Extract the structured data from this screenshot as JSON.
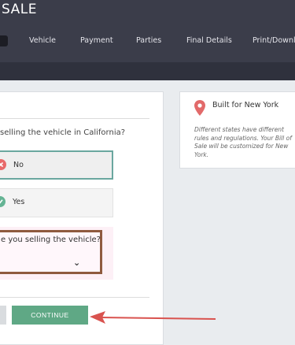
{
  "header": {
    "title": "SALE",
    "nav": [
      "Vehicle",
      "Payment",
      "Parties",
      "Final Details",
      "Print/Download"
    ]
  },
  "question": {
    "text": "selling the vehicle in California?",
    "options": [
      {
        "label": "No",
        "selected": true,
        "icon": "close-icon",
        "color": "#e8696a"
      },
      {
        "label": "Yes",
        "selected": false,
        "icon": "check-icon",
        "color": "#65b494"
      }
    ]
  },
  "subquestion": {
    "text": "e you selling the vehicle?",
    "select_value": ""
  },
  "buttons": {
    "continue": "CONTINUE"
  },
  "info": {
    "title": "Built for New York",
    "text": "Different states have different rules and regulations. Your Bill of Sale will be customized for New York."
  },
  "colors": {
    "header": "#3b3d4a",
    "accent_green": "#5fa885",
    "annotation_red": "#d9534f",
    "outline_brown": "#8f5a3e"
  }
}
